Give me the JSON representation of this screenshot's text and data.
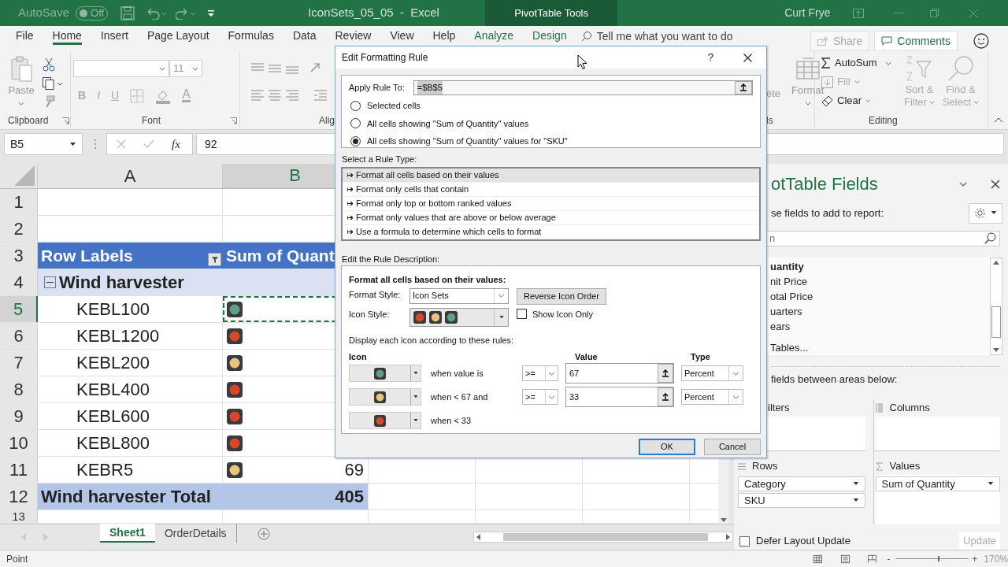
{
  "title_bar": {
    "autosave_label": "AutoSave",
    "autosave_state": "Off",
    "autosave_on": false,
    "document_title": "IconSets_05_05  -  Excel",
    "context_label": "PivotTable Tools",
    "user": "Curt Frye"
  },
  "ribbon_tabs": [
    {
      "label": "File",
      "selected": false,
      "contextual": false
    },
    {
      "label": "Home",
      "selected": true,
      "contextual": false
    },
    {
      "label": "Insert",
      "selected": false,
      "contextual": false
    },
    {
      "label": "Page Layout",
      "selected": false,
      "contextual": false
    },
    {
      "label": "Formulas",
      "selected": false,
      "contextual": false
    },
    {
      "label": "Data",
      "selected": false,
      "contextual": false
    },
    {
      "label": "Review",
      "selected": false,
      "contextual": false
    },
    {
      "label": "View",
      "selected": false,
      "contextual": false
    },
    {
      "label": "Help",
      "selected": false,
      "contextual": false
    },
    {
      "label": "Analyze",
      "selected": false,
      "contextual": true
    },
    {
      "label": "Design",
      "selected": false,
      "contextual": true
    }
  ],
  "tell_me": "Tell me what you want to do",
  "share": "Share",
  "comments": "Comments",
  "ribbon": {
    "paste": "Paste",
    "clipboard_label": "Clipboard",
    "font_size": "11",
    "font_buttons": [
      "B",
      "I",
      "U"
    ],
    "font_color": "A",
    "font_label": "Font",
    "alignment_label": "Alig",
    "delete_partial": "ete",
    "format": "Format",
    "cells_label": "ls",
    "autosum": "AutoSum",
    "fill": "Fill",
    "clear": "Clear",
    "sort_filter": [
      "Sort &",
      "Filter"
    ],
    "find_select": [
      "Find &",
      "Select"
    ],
    "editing_label": "Editing"
  },
  "formula_bar": {
    "name_box": "B5",
    "function_label": "fx",
    "formula": "92"
  },
  "sheet": {
    "columns": [
      {
        "label": "A",
        "selected": false
      },
      {
        "label": "B",
        "selected": true
      }
    ],
    "rows": [
      {
        "number": "1",
        "kind": "blank",
        "selected": false
      },
      {
        "number": "2",
        "kind": "blank",
        "selected": false
      },
      {
        "number": "3",
        "kind": "header",
        "selected": false,
        "label": "Row Labels",
        "value_label": "Sum of Quant"
      },
      {
        "number": "4",
        "kind": "group",
        "selected": false,
        "label": "Wind harvester"
      },
      {
        "number": "5",
        "kind": "item",
        "selected": true,
        "label": "KEBL100",
        "color": "#5f9e8c"
      },
      {
        "number": "6",
        "kind": "item",
        "selected": false,
        "label": "KEBL1200",
        "color": "#d9472b"
      },
      {
        "number": "7",
        "kind": "item",
        "selected": false,
        "label": "KEBL200",
        "color": "#e9c47e"
      },
      {
        "number": "8",
        "kind": "item",
        "selected": false,
        "label": "KEBL400",
        "color": "#d9472b"
      },
      {
        "number": "9",
        "kind": "item",
        "selected": false,
        "label": "KEBL600",
        "color": "#d9472b"
      },
      {
        "number": "10",
        "kind": "item",
        "selected": false,
        "label": "KEBL800",
        "color": "#d9472b"
      },
      {
        "number": "11",
        "kind": "item",
        "selected": false,
        "label": "KEBR5",
        "color": "#e9c47e",
        "value": "69"
      },
      {
        "number": "12",
        "kind": "total",
        "selected": false,
        "label": "Wind harvester Total",
        "value": "405"
      },
      {
        "number": "13",
        "kind": "blank",
        "selected": false
      }
    ],
    "tabs": [
      {
        "label": "Sheet1",
        "selected": true
      },
      {
        "label": "OrderDetails",
        "selected": false
      }
    ]
  },
  "status_bar": {
    "mode": "Point",
    "zoom_out": "-",
    "zoom_in": "+",
    "zoom": "170%"
  },
  "pivot_panel": {
    "title": "otTable Fields",
    "subtitle": "se fields to add to report:",
    "search": "n",
    "fields": [
      {
        "label": "uantity",
        "in_use": true
      },
      {
        "label": "nit Price",
        "in_use": false
      },
      {
        "label": "otal Price",
        "in_use": false
      },
      {
        "label": "uarters",
        "in_use": false
      },
      {
        "label": "ears",
        "in_use": false
      }
    ],
    "more_tables": "Tables...",
    "drag_caption": "fields between areas below:",
    "filters_label": "ilters",
    "columns_label": "Columns",
    "rows_label": "Rows",
    "values_label": "Values",
    "rows": [
      "Category",
      "SKU"
    ],
    "values": [
      "Sum of Quantity"
    ],
    "defer": {
      "label": "Defer Layout Update",
      "checked": false
    },
    "update": "Update"
  },
  "dialog": {
    "title": "Edit Formatting Rule",
    "help": "?",
    "apply_label": "Apply Rule To:",
    "apply_value": "=$B$5",
    "scope_options": [
      {
        "label": "Selected cells",
        "selected": false
      },
      {
        "label": "All cells showing \"Sum of Quantity\" values",
        "selected": false
      },
      {
        "label": "All cells showing \"Sum of Quantity\" values for \"SKU\"",
        "selected": true
      }
    ],
    "rule_type_label": "Select a Rule Type:",
    "rule_types": [
      {
        "label": "Format all cells based on their values",
        "selected": true
      },
      {
        "label": "Format only cells that contain",
        "selected": false
      },
      {
        "label": "Format only top or bottom ranked values",
        "selected": false
      },
      {
        "label": "Format only values that are above or below average",
        "selected": false
      },
      {
        "label": "Use a formula to determine which cells to format",
        "selected": false
      }
    ],
    "description_label": "Edit the Rule Description:",
    "heading": "Format all cells based on their values:",
    "format_style_label": "Format Style:",
    "format_style": "Icon Sets",
    "reverse_button": "Reverse Icon Order",
    "icon_style_label": "Icon Style:",
    "icon_style": [
      {
        "color": "#d9472b"
      },
      {
        "color": "#e9c47e"
      },
      {
        "color": "#5f9e8c"
      }
    ],
    "show_icon_only": {
      "label": "Show Icon Only",
      "checked": false
    },
    "rules_caption": "Display each icon according to these rules:",
    "rule_columns": [
      "Icon",
      "Value",
      "Type"
    ],
    "rules": [
      {
        "color": "#5f9e8c",
        "condition": "when value is",
        "operator": ">=",
        "value": "67",
        "type": "Percent"
      },
      {
        "color": "#e9c47e",
        "condition": "when < 67 and",
        "operator": ">=",
        "value": "33",
        "type": "Percent"
      },
      {
        "color": "#d9472b",
        "condition": "when < 33"
      }
    ],
    "ok": "OK",
    "cancel": "Cancel"
  }
}
